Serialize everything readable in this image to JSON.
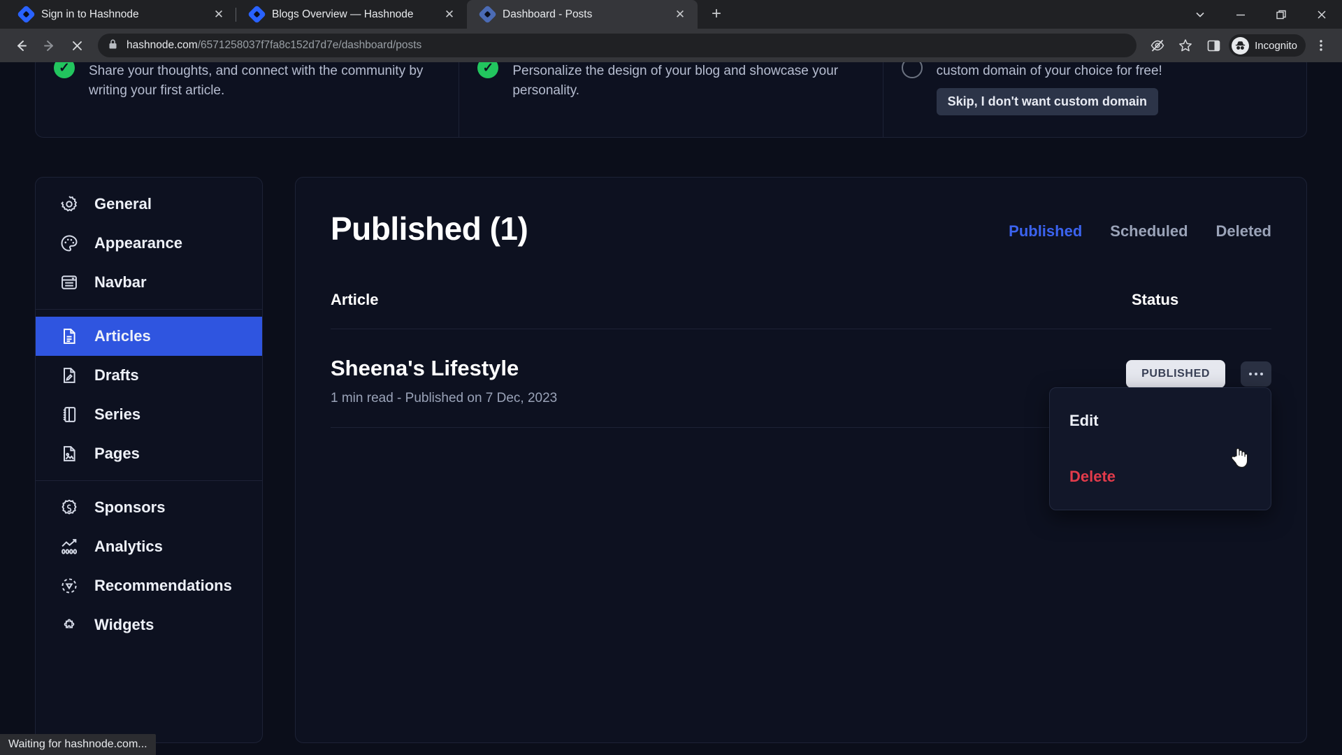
{
  "browser": {
    "tabs": [
      {
        "title": "Sign in to Hashnode",
        "favicon": "hashnode-logo-icon",
        "active": false
      },
      {
        "title": "Blogs Overview — Hashnode",
        "favicon": "hashnode-logo-icon",
        "active": false
      },
      {
        "title": "Dashboard - Posts",
        "favicon": "hashnode-loading-icon",
        "active": true
      }
    ],
    "new_tab_label": "+",
    "window_controls": [
      "chevron-down",
      "minimize",
      "restore",
      "close"
    ],
    "toolbar": {
      "back_label": "←",
      "forward_label": "→",
      "stop_label": "✕",
      "url_host": "hashnode.com",
      "url_path": "/6571258037f7fa8c152d7d7e/dashboard/posts",
      "profile_label": "Incognito"
    },
    "status_text": "Waiting for hashnode.com..."
  },
  "banner": {
    "cards": [
      {
        "icon": "check-circle-filled-icon",
        "state": "done",
        "text": "Share your thoughts, and connect with the community by writing your first article."
      },
      {
        "icon": "check-circle-filled-icon",
        "state": "done",
        "text": "Personalize the design of your blog and showcase your personality."
      },
      {
        "icon": "circle-outline-icon",
        "state": "pending",
        "text": "custom domain of your choice for free!",
        "button": "Skip, I don't want custom domain"
      }
    ]
  },
  "sidebar": {
    "groups": [
      {
        "items": [
          {
            "label": "General",
            "icon": "gear-icon",
            "active": false
          },
          {
            "label": "Appearance",
            "icon": "palette-icon",
            "active": false
          },
          {
            "label": "Navbar",
            "icon": "navbar-icon",
            "active": false
          }
        ]
      },
      {
        "items": [
          {
            "label": "Articles",
            "icon": "document-lines-icon",
            "active": true
          },
          {
            "label": "Drafts",
            "icon": "document-pencil-icon",
            "active": false
          },
          {
            "label": "Series",
            "icon": "book-icon",
            "active": false
          },
          {
            "label": "Pages",
            "icon": "document-image-icon",
            "active": false
          }
        ]
      },
      {
        "items": [
          {
            "label": "Sponsors",
            "icon": "dollar-badge-icon",
            "active": false
          },
          {
            "label": "Analytics",
            "icon": "chart-icon",
            "active": false
          },
          {
            "label": "Recommendations",
            "icon": "recommendations-icon",
            "active": false
          },
          {
            "label": "Widgets",
            "icon": "puzzle-icon",
            "active": false
          }
        ]
      }
    ]
  },
  "main": {
    "title": "Published (1)",
    "tabs": [
      {
        "label": "Published",
        "active": true
      },
      {
        "label": "Scheduled",
        "active": false
      },
      {
        "label": "Deleted",
        "active": false
      }
    ],
    "table": {
      "headers": {
        "article": "Article",
        "status": "Status"
      },
      "rows": [
        {
          "title": "Sheena's Lifestyle",
          "meta": "1 min read - Published on 7 Dec, 2023",
          "status_badge": "PUBLISHED",
          "kebab": "more-options-icon"
        }
      ]
    },
    "context_menu": {
      "open": true,
      "items": [
        {
          "label": "Edit",
          "kind": "edit"
        },
        {
          "label": "Delete",
          "kind": "delete"
        }
      ]
    }
  },
  "colors": {
    "accent": "#2f55e0",
    "tab_active": "#3b63ef",
    "danger": "#e23b4b",
    "success": "#22c55e",
    "page_bg": "#0b0e1a",
    "panel_bg": "#0d1120",
    "badge_bg": "#e6e8ef"
  }
}
